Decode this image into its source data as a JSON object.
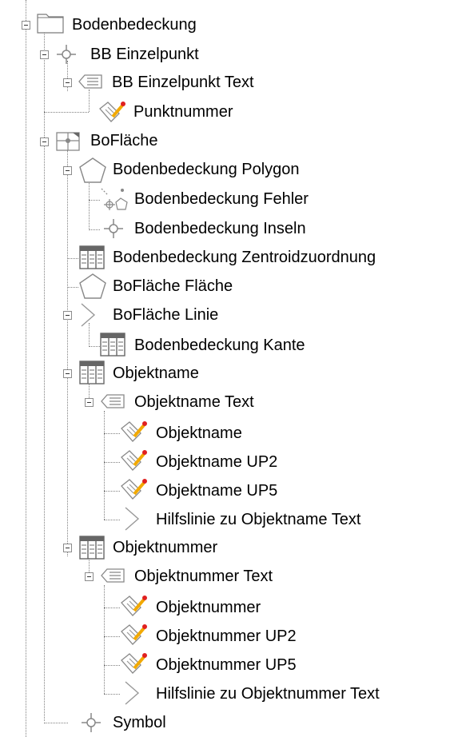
{
  "tree": {
    "items": [
      {
        "label": "Bodenbedeckung",
        "icon": "folder-icon",
        "expanded": true
      },
      {
        "label": "BB Einzelpunkt",
        "icon": "point-feature-icon",
        "expanded": true
      },
      {
        "label": "BB Einzelpunkt Text",
        "icon": "text-table-icon",
        "expanded": true
      },
      {
        "label": "Punktnummer",
        "icon": "annotation-class-icon"
      },
      {
        "label": "BoFläche",
        "icon": "topology-icon",
        "expanded": true
      },
      {
        "label": "Bodenbedeckung Polygon",
        "icon": "polygon-icon",
        "expanded": true
      },
      {
        "label": "Bodenbedeckung Fehler",
        "icon": "error-feature-icon"
      },
      {
        "label": "Bodenbedeckung Inseln",
        "icon": "point-feature-icon"
      },
      {
        "label": "Bodenbedeckung Zentroidzuordnung",
        "icon": "table-icon"
      },
      {
        "label": "BoFläche Fläche",
        "icon": "polygon-icon"
      },
      {
        "label": "BoFläche Linie",
        "icon": "line-feature-icon",
        "expanded": true
      },
      {
        "label": "Bodenbedeckung Kante",
        "icon": "table-icon"
      },
      {
        "label": "Objektname",
        "icon": "table-icon",
        "expanded": true
      },
      {
        "label": "Objektname Text",
        "icon": "text-table-icon",
        "expanded": true
      },
      {
        "label": "Objektname",
        "icon": "annotation-class-icon"
      },
      {
        "label": "Objektname UP2",
        "icon": "annotation-class-icon"
      },
      {
        "label": "Objektname UP5",
        "icon": "annotation-class-icon"
      },
      {
        "label": "Hilfslinie zu Objektname Text",
        "icon": "line-feature-icon"
      },
      {
        "label": "Objektnummer",
        "icon": "table-icon",
        "expanded": true
      },
      {
        "label": "Objektnummer Text",
        "icon": "text-table-icon",
        "expanded": true
      },
      {
        "label": "Objektnummer",
        "icon": "annotation-class-icon"
      },
      {
        "label": "Objektnummer UP2",
        "icon": "annotation-class-icon"
      },
      {
        "label": "Objektnummer UP5",
        "icon": "annotation-class-icon"
      },
      {
        "label": "Hilfslinie zu Objektnummer Text",
        "icon": "line-feature-icon"
      },
      {
        "label": "Symbol",
        "icon": "point-feature-icon"
      }
    ]
  }
}
